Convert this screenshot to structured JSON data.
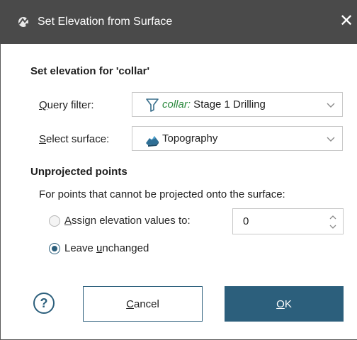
{
  "window": {
    "title": "Set Elevation from Surface",
    "close_glyph": "✕"
  },
  "set_elevation": {
    "heading": "Set elevation for 'collar'",
    "query_filter": {
      "label_mnemonic": "Q",
      "label_rest": "uery filter:",
      "value_object": "collar:",
      "value_filter": " Stage 1 Drilling",
      "icon": "funnel-icon"
    },
    "select_surface": {
      "label_mnemonic": "S",
      "label_rest": "elect surface:",
      "value": "Topography",
      "icon": "surface-icon"
    }
  },
  "unprojected": {
    "heading": "Unprojected points",
    "description": "For points that cannot be projected onto the surface:",
    "assign_option": {
      "label_mnemonic": "A",
      "label_rest": "ssign elevation values to:",
      "checked": false,
      "value": "0"
    },
    "leave_option": {
      "label_before": "Leave ",
      "label_mnemonic": "u",
      "label_rest": "nchanged",
      "checked": true
    }
  },
  "footer": {
    "help_glyph": "?",
    "cancel_mnemonic": "C",
    "cancel_rest": "ancel",
    "ok_mnemonic": "O",
    "ok_rest": "K"
  },
  "colors": {
    "titlebar": "#4a4a4a",
    "accent": "#2c5f7c",
    "object_name_green": "#2b8a3e"
  }
}
